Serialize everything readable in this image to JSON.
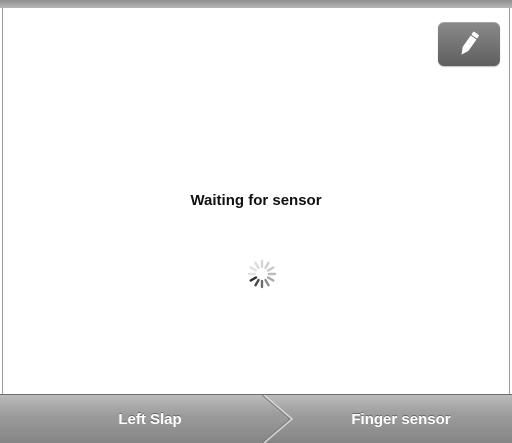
{
  "status": {
    "message": "Waiting for sensor"
  },
  "toolbar": {
    "edit_icon": "pencil-icon",
    "edit_button_color": "#6f6f6f"
  },
  "spinner": {
    "icon": "spinner-icon",
    "state": "loading"
  },
  "steps": [
    {
      "label": "Left Slap"
    },
    {
      "label": "Finger sensor"
    }
  ]
}
